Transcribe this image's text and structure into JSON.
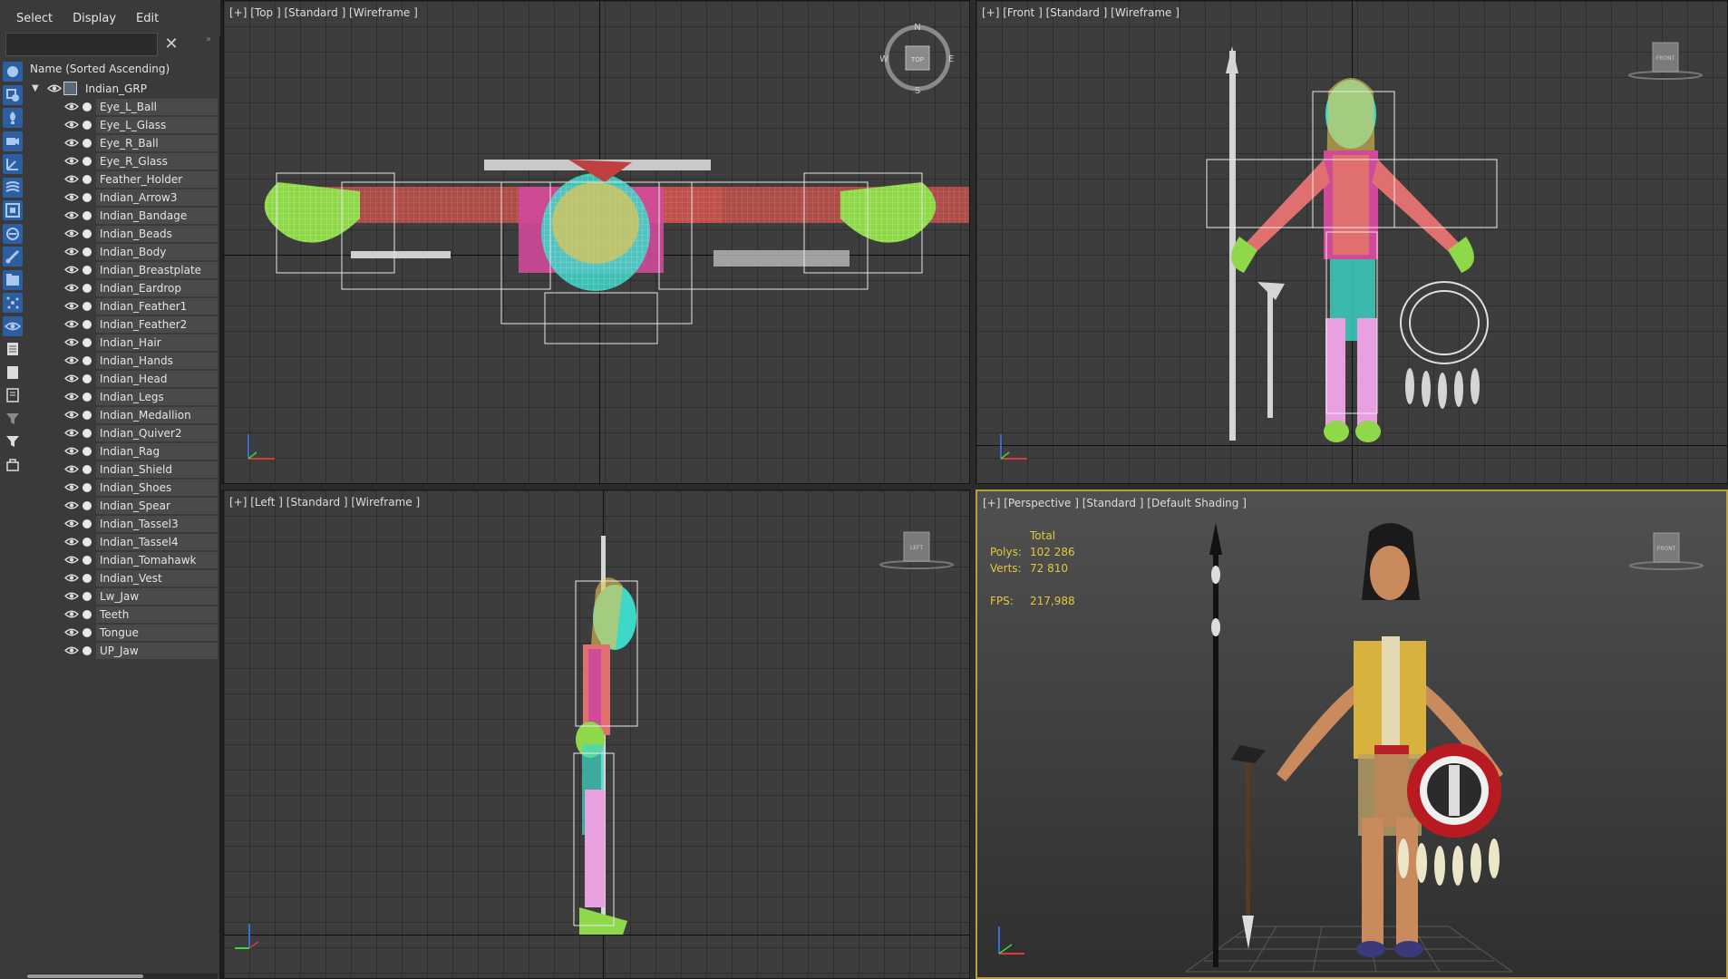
{
  "menu": {
    "items": [
      "Select",
      "Display",
      "Edit"
    ]
  },
  "search": {
    "value": "",
    "placeholder": "",
    "clear_glyph": "✕"
  },
  "explorer": {
    "sort_header": "Name (Sorted Ascending)",
    "root": {
      "name": "Indian_GRP",
      "expanded": true
    },
    "items": [
      "Eye_L_Ball",
      "Eye_L_Glass",
      "Eye_R_Ball",
      "Eye_R_Glass",
      "Feather_Holder",
      "Indian_Arrow3",
      "Indian_Bandage",
      "Indian_Beads",
      "Indian_Body",
      "Indian_Breastplate",
      "Indian_Eardrop",
      "Indian_Feather1",
      "Indian_Feather2",
      "Indian_Hair",
      "Indian_Hands",
      "Indian_Head",
      "Indian_Legs",
      "Indian_Medallion",
      "Indian_Quiver2",
      "Indian_Rag",
      "Indian_Shield",
      "Indian_Shoes",
      "Indian_Spear",
      "Indian_Tassel3",
      "Indian_Tassel4",
      "Indian_Tomahawk",
      "Indian_Vest",
      "Lw_Jaw",
      "Teeth",
      "Tongue",
      "UP_Jaw"
    ],
    "tool_icons": [
      "sphere-icon",
      "shapes-icon",
      "light-icon",
      "camera-icon",
      "helper-icon",
      "spacewarp-icon",
      "group-icon",
      "xref-icon",
      "bone-icon",
      "container-icon",
      "particle-icon",
      "visibility-icon",
      "layer-icon",
      "layer-list-icon",
      "properties-icon",
      "filter-icon",
      "funnel-icon",
      "selection-set-icon"
    ]
  },
  "viewports": {
    "top": {
      "label": "[+] [Top ] [Standard ] [Wireframe ]",
      "cube": "TOP",
      "compass": [
        "N",
        "E",
        "S",
        "W"
      ]
    },
    "front": {
      "label": "[+] [Front ] [Standard ] [Wireframe ]",
      "cube": "FRONT"
    },
    "left": {
      "label": "[+] [Left ] [Standard ] [Wireframe ]",
      "cube": "LEFT"
    },
    "perspective": {
      "label": "[+] [Perspective ] [Standard ] [Default Shading ]",
      "cube": "FRONT",
      "stats": {
        "header": "Total",
        "polys_label": "Polys:",
        "polys": "102 286",
        "verts_label": "Verts:",
        "verts": "72 810",
        "fps_label": "FPS:",
        "fps": "217,988"
      }
    }
  },
  "colors": {
    "accent": "#b9a03c",
    "stats": "#e2c93c",
    "panel": "#3a3a3a",
    "viewport": "#3d3d3d"
  }
}
